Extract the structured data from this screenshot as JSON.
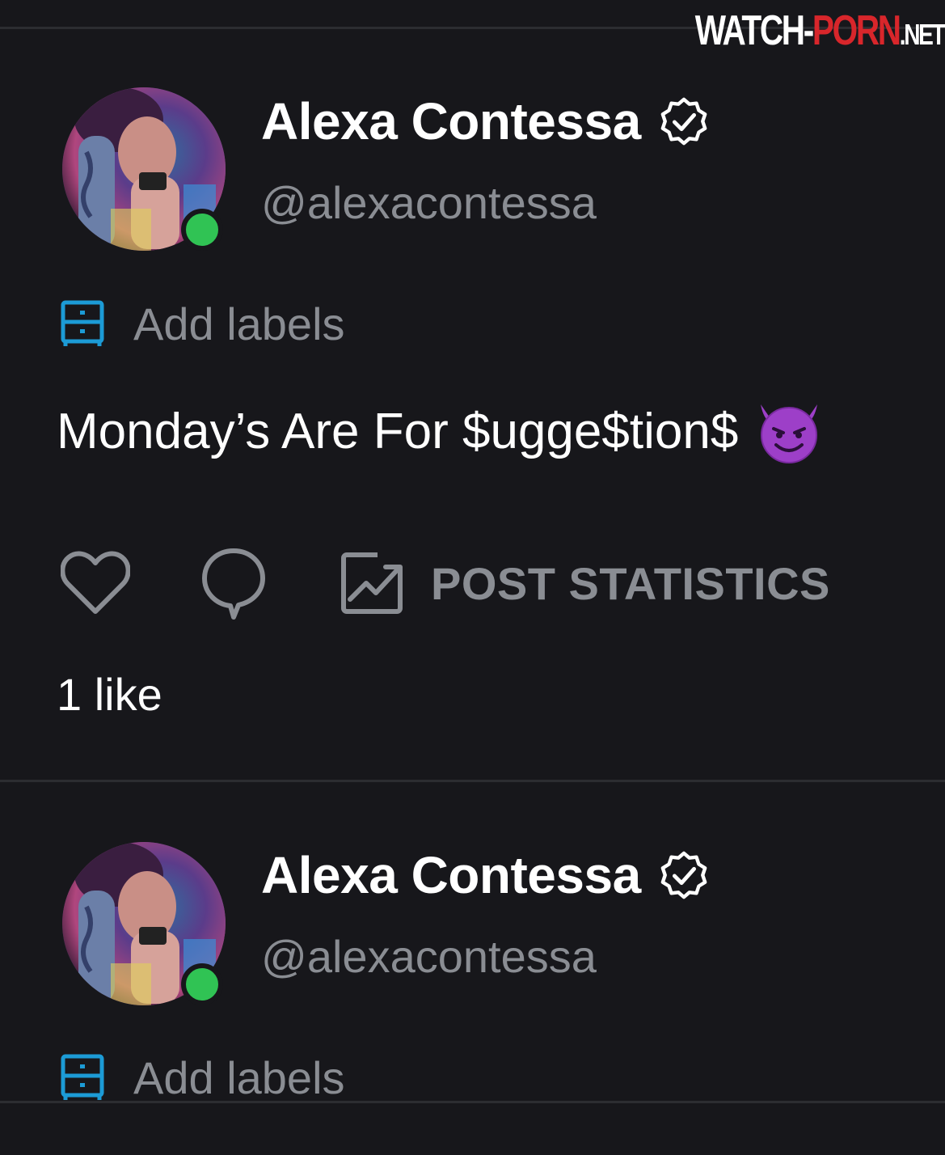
{
  "watermark": {
    "part1": "WATCH-",
    "part2": "PORN",
    "part3": ".NET"
  },
  "colors": {
    "background": "#17171b",
    "muted_text": "#8a8d93",
    "accent_blue": "#1c9bd6",
    "online_green": "#30c354",
    "divider": "#2c2d31"
  },
  "posts": [
    {
      "author": {
        "name": "Alexa Contessa",
        "handle": "@alexacontessa",
        "verified_icon": "verified-badge-icon",
        "online": true
      },
      "labels_action": {
        "icon": "labels-icon",
        "label": "Add labels"
      },
      "caption": {
        "text": "Monday’s Are For $ugge$tion$",
        "emoji_icon": "smiling-devil-icon"
      },
      "actions": {
        "like_icon": "heart-icon",
        "comment_icon": "comment-icon",
        "stats_icon": "post-statistics-icon",
        "stats_label": "POST STATISTICS"
      },
      "likes_text": "1 like"
    },
    {
      "author": {
        "name": "Alexa Contessa",
        "handle": "@alexacontessa",
        "verified_icon": "verified-badge-icon",
        "online": true
      },
      "labels_action": {
        "icon": "labels-icon",
        "label": "Add labels"
      }
    }
  ]
}
